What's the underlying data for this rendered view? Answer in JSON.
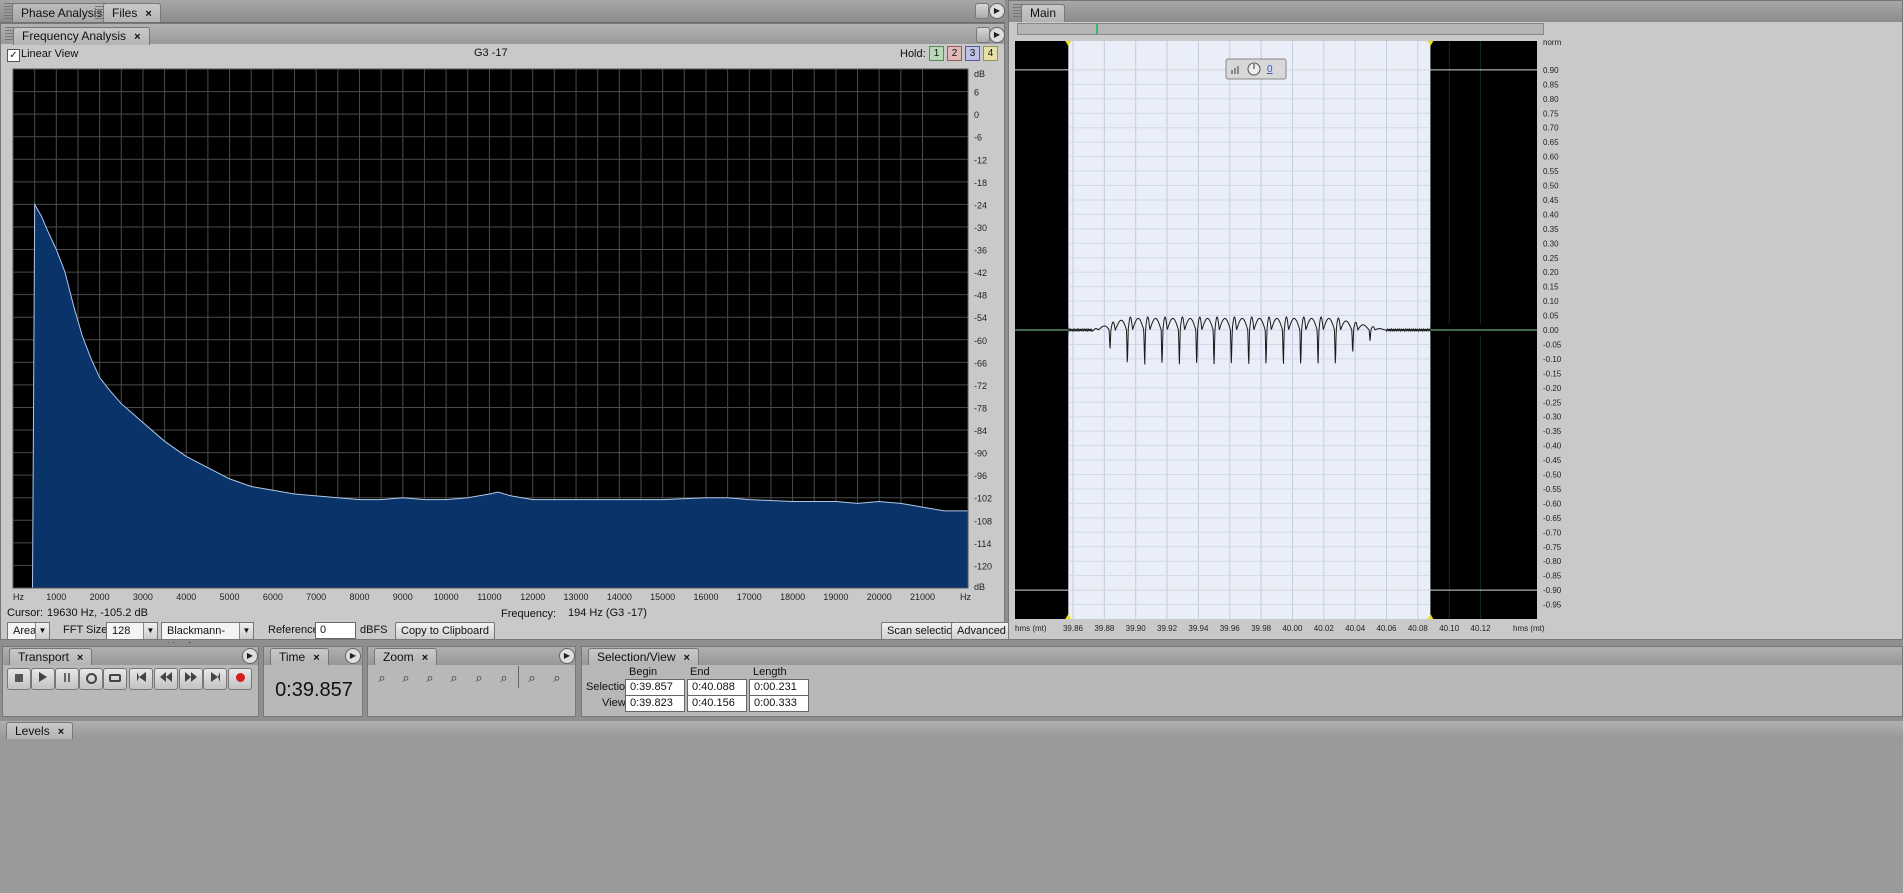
{
  "tabs_left": {
    "phase": "Phase Analysis",
    "files": "Files"
  },
  "freq_tab": "Frequency Analysis",
  "linear_view": "Linear View",
  "note_label": "G3 -17",
  "hold": {
    "label": "Hold:",
    "b1": "1",
    "b2": "2",
    "b3": "3",
    "b4": "4"
  },
  "icons": {
    "close": "×",
    "chevron": "▼",
    "play_menu": "▶"
  },
  "freq_chart": {
    "title": "",
    "y_unit": "dB",
    "x_unit": "Hz",
    "y_ticks": [
      "6",
      "0",
      "-6",
      "-12",
      "-18",
      "-24",
      "-30",
      "-36",
      "-42",
      "-48",
      "-54",
      "-60",
      "-66",
      "-72",
      "-78",
      "-84",
      "-90",
      "-96",
      "-102",
      "-108",
      "-114",
      "-120"
    ],
    "x_ticks": [
      "1000",
      "2000",
      "3000",
      "4000",
      "5000",
      "6000",
      "7000",
      "8000",
      "9000",
      "10000",
      "11000",
      "12000",
      "13000",
      "14000",
      "15000",
      "16000",
      "17000",
      "18000",
      "19000",
      "20000",
      "21000"
    ]
  },
  "chart_data": [
    {
      "type": "area",
      "xlabel": "Hz",
      "ylabel": "dB",
      "xlim": [
        0,
        22050
      ],
      "ylim": [
        -126,
        12
      ],
      "x": [
        450,
        500,
        550,
        650,
        800,
        1000,
        1200,
        1400,
        1600,
        1800,
        2000,
        2200,
        2500,
        2800,
        3000,
        3500,
        4000,
        4500,
        5000,
        5500,
        6000,
        6500,
        7000,
        7500,
        8000,
        8500,
        9000,
        9500,
        10000,
        10500,
        11000,
        11200,
        11500,
        12000,
        13000,
        14000,
        15000,
        16000,
        16500,
        17000,
        18000,
        19000,
        19500,
        20000,
        20500,
        21000,
        21500,
        22050
      ],
      "y": [
        -126,
        -24,
        -25,
        -27,
        -31,
        -36,
        -42,
        -51,
        -59,
        -65,
        -70,
        -73,
        -77,
        -80,
        -82,
        -87,
        -91,
        -94,
        -97,
        -99,
        -100,
        -101,
        -101.5,
        -102,
        -102.5,
        -102.5,
        -102,
        -102.5,
        -102.5,
        -102,
        -101,
        -100.5,
        -101.5,
        -102.5,
        -102.5,
        -102.5,
        -102.5,
        -102,
        -102,
        -102.5,
        -103,
        -103,
        -103.5,
        -103,
        -103.5,
        -104.5,
        -105.5,
        -105.5
      ]
    },
    {
      "type": "line",
      "xlabel": "hms (mt)",
      "ylabel": "norm",
      "xlim": [
        39.823,
        40.156
      ],
      "ylim": [
        -1,
        1
      ],
      "x_ticks": [
        "39.86",
        "39.88",
        "39.90",
        "39.92",
        "39.94",
        "39.96",
        "39.98",
        "40.00",
        "40.02",
        "40.04",
        "40.06",
        "40.08",
        "40.10",
        "40.12"
      ],
      "y_ticks": [
        "0.90",
        "0.85",
        "0.80",
        "0.75",
        "0.70",
        "0.65",
        "0.60",
        "0.55",
        "0.50",
        "0.45",
        "0.40",
        "0.35",
        "0.30",
        "0.25",
        "0.20",
        "0.15",
        "0.10",
        "0.05",
        "0.00",
        "-0.05",
        "-0.10",
        "-0.15",
        "-0.20",
        "-0.25",
        "-0.30",
        "-0.35",
        "-0.40",
        "-0.45",
        "-0.50",
        "-0.55",
        "-0.60",
        "-0.65",
        "-0.70",
        "-0.75",
        "-0.80",
        "-0.85",
        "-0.90",
        "-0.95"
      ],
      "selection": [
        39.857,
        40.088
      ],
      "burst_start": 39.872,
      "burst_end": 40.06,
      "burst_count": 17
    }
  ],
  "cursor": {
    "label": "Cursor:",
    "value": "19630 Hz, -105.2 dB"
  },
  "frequency": {
    "label": "Frequency:",
    "value": "194 Hz (G3 -17)"
  },
  "controls": {
    "mode": "Area",
    "fft_label": "FFT Size:",
    "fft": "128",
    "window": "Blackmann-Harris",
    "ref_label": "Reference:",
    "ref_value": "0",
    "ref_unit": "dBFS",
    "copy": "Copy to Clipboard",
    "scan": "Scan selection",
    "advanced": "Advanced"
  },
  "main_tab": "Main",
  "wave": {
    "left_unit": "hms (mt)",
    "right_unit": "hms (mt)",
    "y_unit": "norm",
    "volume": "0"
  },
  "transport": {
    "tab": "Transport"
  },
  "time": {
    "tab": "Time",
    "value": "0:39.857"
  },
  "zoom": {
    "tab": "Zoom"
  },
  "selview": {
    "tab": "Selection/View",
    "begin": "Begin",
    "end": "End",
    "length": "Length",
    "selection_label": "Selection",
    "view_label": "View",
    "sel_begin": "0:39.857",
    "sel_end": "0:40.088",
    "sel_length": "0:00.231",
    "view_begin": "0:39.823",
    "view_end": "0:40.156",
    "view_length": "0:00.333"
  },
  "levels": {
    "tab": "Levels"
  }
}
